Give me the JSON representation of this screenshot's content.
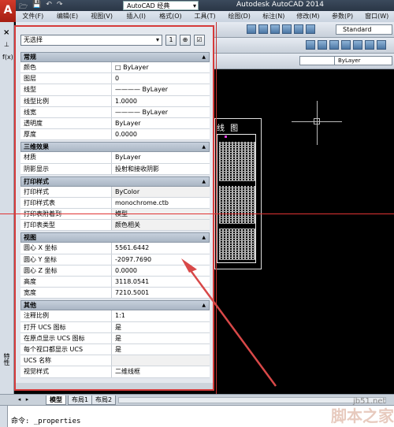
{
  "titlebar": {
    "app_logo": "A",
    "quick_access": [
      "🗁",
      "💾",
      "↶",
      "↷"
    ],
    "workspace": "AutoCAD 经典",
    "app_title": "Autodesk AutoCAD 2014"
  },
  "menu": [
    "文件(F)",
    "编辑(E)",
    "视图(V)",
    "插入(I)",
    "格式(O)",
    "工具(T)",
    "绘图(D)",
    "标注(N)",
    "修改(M)",
    "参数(P)",
    "窗口(W)"
  ],
  "toolbar": {
    "style_combo": "Standard",
    "layer_value": "ByLayer"
  },
  "left_strip": {
    "close": "×",
    "pin": "⊥",
    "formula": "f(x)",
    "vertical_title": "特性"
  },
  "palette": {
    "selection": "无选择",
    "buttons": [
      "1",
      "⊕",
      "☑"
    ],
    "categories": [
      {
        "title": "常规",
        "rows": [
          {
            "name": "颜色",
            "value": "□ ByLayer"
          },
          {
            "name": "图层",
            "value": "0"
          },
          {
            "name": "线型",
            "value": "———— ByLayer"
          },
          {
            "name": "线型比例",
            "value": "1.0000"
          },
          {
            "name": "线宽",
            "value": "———— ByLayer"
          },
          {
            "name": "透明度",
            "value": "ByLayer"
          },
          {
            "name": "厚度",
            "value": "0.0000"
          }
        ]
      },
      {
        "title": "三维效果",
        "rows": [
          {
            "name": "材质",
            "value": "ByLayer"
          },
          {
            "name": "阴影显示",
            "value": "投射和接收阴影"
          }
        ]
      },
      {
        "title": "打印样式",
        "rows": [
          {
            "name": "打印样式",
            "value": "ByColor"
          },
          {
            "name": "打印样式表",
            "value": "monochrome.ctb"
          },
          {
            "name": "打印表附着到",
            "value": "模型"
          },
          {
            "name": "打印表类型",
            "value": "颜色相关"
          }
        ]
      },
      {
        "title": "视图",
        "rows": [
          {
            "name": "圆心 X 坐标",
            "value": "5561.6442"
          },
          {
            "name": "圆心 Y 坐标",
            "value": "-2097.7690"
          },
          {
            "name": "圆心 Z 坐标",
            "value": "0.0000"
          },
          {
            "name": "高度",
            "value": "3118.0541"
          },
          {
            "name": "宽度",
            "value": "7210.5001"
          }
        ]
      },
      {
        "title": "其他",
        "rows": [
          {
            "name": "注释比例",
            "value": "1:1"
          },
          {
            "name": "打开 UCS 图标",
            "value": "是"
          },
          {
            "name": "在原点显示 UCS 图标",
            "value": "是"
          },
          {
            "name": "每个视口都显示 UCS",
            "value": "是"
          },
          {
            "name": "UCS 名称",
            "value": ""
          },
          {
            "name": "视觉样式",
            "value": "二维线框"
          }
        ]
      }
    ]
  },
  "drawing": {
    "sheet_title": "线 图"
  },
  "tabs": {
    "nav": [
      "◂",
      "▸"
    ],
    "items": [
      "模型",
      "布局1",
      "布局2"
    ]
  },
  "command": {
    "text": "命令: _properties"
  },
  "watermark": {
    "url": "jb51.net",
    "name": "脚本之家"
  }
}
